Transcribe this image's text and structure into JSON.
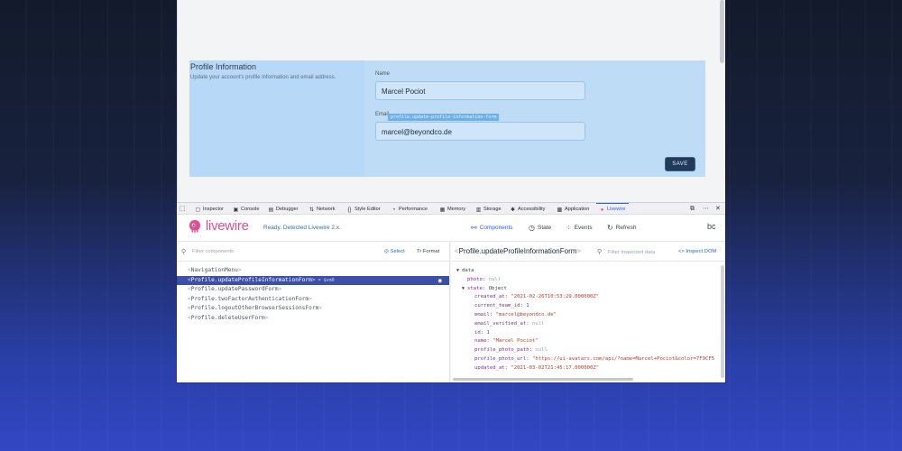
{
  "page": {
    "section_title": "Profile Information",
    "section_desc": "Update your account's profile information and email address.",
    "name_label": "Name",
    "name_value": "Marcel Pociot",
    "email_label": "Email",
    "email_value": "marcel@beyondco.de",
    "component_tag": "profile.update-profile-information-form",
    "save_label": "SAVE"
  },
  "devtools_tabs": [
    {
      "label": "Inspector",
      "icon": "inspector-icon"
    },
    {
      "label": "Console",
      "icon": "console-icon"
    },
    {
      "label": "Debugger",
      "icon": "debugger-icon"
    },
    {
      "label": "Network",
      "icon": "network-icon"
    },
    {
      "label": "Style Editor",
      "icon": "style-editor-icon"
    },
    {
      "label": "Performance",
      "icon": "performance-icon"
    },
    {
      "label": "Memory",
      "icon": "memory-icon"
    },
    {
      "label": "Storage",
      "icon": "storage-icon"
    },
    {
      "label": "Accessibility",
      "icon": "accessibility-icon"
    },
    {
      "label": "Application",
      "icon": "application-icon"
    },
    {
      "label": "Livewire",
      "icon": "livewire-icon"
    }
  ],
  "livewire": {
    "wordmark": "livewire",
    "status": "Ready. Detected Livewire 2.x.",
    "nav": {
      "components": "Components",
      "state": "State",
      "events": "Events",
      "refresh": "Refresh"
    },
    "filter_placeholder": "Filter components",
    "select_label": "Select",
    "format_label": "Format",
    "tree": [
      "NavigationMenu",
      "Profile.updateProfileInformationForm",
      "Profile.updatePasswordForm",
      "Profile.twoFactorAuthenticationForm",
      "Profile.logoutOtherBrowserSessionsForm",
      "Profile.deleteUserForm"
    ],
    "selected_note": "= $vm0",
    "selected_component": "Profile.updateProfileInformationForm",
    "filter_data_placeholder": "Filter inspected data",
    "inspect_dom": "Inspect DOM",
    "state": {
      "data_label": "data",
      "photo_key": "photo:",
      "photo_val": "null",
      "state_key": "state:",
      "state_val": "Object",
      "created_at_key": "created_at:",
      "created_at_val": "\"2021-02-26T10:53:29.000000Z\"",
      "current_team_id_key": "current_team_id:",
      "current_team_id_val": "1",
      "email_key": "email:",
      "email_val": "\"marcel@beyondco.de\"",
      "email_verified_at_key": "email_verified_at:",
      "email_verified_at_val": "null",
      "id_key": "id:",
      "id_val": "1",
      "name_key": "name:",
      "name_val": "\"Marcel Pociot\"",
      "profile_photo_path_key": "profile_photo_path:",
      "profile_photo_path_val": "null",
      "profile_photo_url_key": "profile_photo_url:",
      "profile_photo_url_val": "\"https://ui-avatars.com/api/?name=Marcel+Pociot&color=7F9CF5",
      "updated_at_key": "updated_at:",
      "updated_at_val": "\"2021-03-02T21:45:17.000000Z\""
    }
  },
  "colors": {
    "highlight": "#bfdcf7",
    "accent": "#2563eb",
    "brand": "#e04f93",
    "selected_row": "#3d4fa6"
  }
}
